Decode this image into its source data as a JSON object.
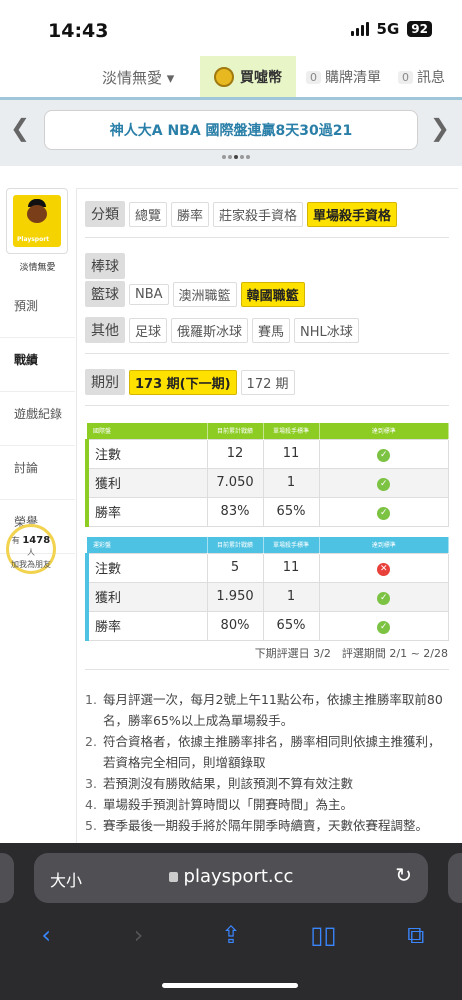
{
  "status": {
    "time": "14:43",
    "network": "5G",
    "battery": "92"
  },
  "topnav": {
    "user": "淡情無愛 ▾",
    "buy": "買噓幣",
    "cart_count": "0",
    "cart": "購牌清單",
    "msg_count": "0",
    "msg": "訊息"
  },
  "banner": {
    "text": "神人大A NBA 國際盤連贏8天30過21"
  },
  "sidebar": {
    "name": "淡情無愛",
    "avatar_text": "Playsport",
    "items": [
      "預測",
      "戰績",
      "遊戲紀錄",
      "討論",
      "榮譽"
    ],
    "count_prefix": "有",
    "count": "1478",
    "count_suffix": "人",
    "count_note": "加我為朋友"
  },
  "filters": {
    "category_label": "分類",
    "category_options": [
      "總覽",
      "勝率",
      "莊家殺手資格",
      "單場殺手資格"
    ],
    "baseball_label": "棒球",
    "basketball_label": "籃球",
    "basketball_options": [
      "NBA",
      "澳洲職籃",
      "韓國職籃"
    ],
    "other_label": "其他",
    "other_options": [
      "足球",
      "俄羅斯冰球",
      "賽馬",
      "NHL冰球"
    ],
    "period_label": "期別",
    "period_options": [
      "173 期(下一期)",
      "172 期"
    ]
  },
  "table1": {
    "headers": [
      "國際盤",
      "目前累計戰績",
      "單場殺手標準",
      "達到標準"
    ],
    "rows": [
      {
        "label": "注數",
        "current": "12",
        "standard": "11",
        "status": "ok"
      },
      {
        "label": "獲利",
        "current": "7.050",
        "standard": "1",
        "status": "ok"
      },
      {
        "label": "勝率",
        "current": "83%",
        "standard": "65%",
        "status": "ok"
      }
    ]
  },
  "table2": {
    "headers": [
      "運彩盤",
      "目前累計戰績",
      "單場殺手標準",
      "達到標準"
    ],
    "rows": [
      {
        "label": "注數",
        "current": "5",
        "standard": "11",
        "status": "fail"
      },
      {
        "label": "獲利",
        "current": "1.950",
        "standard": "1",
        "status": "ok"
      },
      {
        "label": "勝率",
        "current": "80%",
        "standard": "65%",
        "status": "ok"
      }
    ]
  },
  "dates": "下期評選日 3/2　評選期間 2/1 ~ 2/28",
  "notes": [
    "每月評選一次，每月2號上午11點公布，依據主推勝率取前80名，勝率65%以上成為單場殺手。",
    "符合資格者，依據主推勝率排名，勝率相同則依據主推獲利，若資格完全相同，則增額錄取",
    "若預測沒有勝敗結果，則該預測不算有效注數",
    "單場殺手預測計算時間以「開賽時間」為主。",
    "賽季最後一期殺手將於隔年開季時續賣，天數依賽程調整。"
  ],
  "browser": {
    "text_size": "大小",
    "url": "playsport.cc"
  },
  "colors": {
    "accent_yellow": "#ffe100",
    "green": "#8ccc23",
    "blue": "#4ec2e2"
  }
}
